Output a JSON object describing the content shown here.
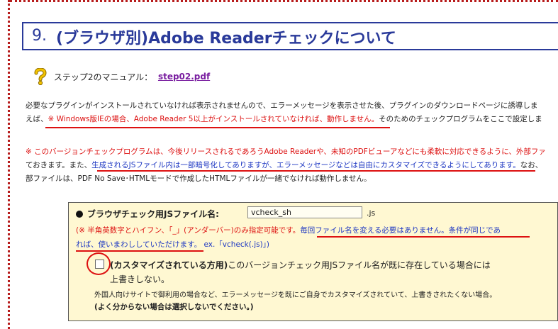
{
  "section": {
    "number": "9.",
    "title": "(ブラウザ別)Adobe Readerチェックについて"
  },
  "step": {
    "label": "ステップ2のマニュアル：",
    "link": "step02.pdf"
  },
  "para1": {
    "line1": "必要なプラグインがインストールされていなければ表示されませんので、エラーメッセージを表示させた後、プラグインのダウンロードページに誘導しま",
    "line2_prefix": "えば、",
    "line2_highlight": "※ Windows版IEの場合、Adobe Reader 5以上がインストールされていなければ、動作しません。",
    "line2_suffix": "そのためのチェックプログラムをここで設定しま"
  },
  "para2": {
    "line1": "※ このバージョンチェックプログラムは、今後リリースされるであろうAdobe Readerや、未知のPDFビューアなどにも柔軟に対応できるように、外部ファ",
    "line2_prefix": "ておきます。また、",
    "line2_highlight": "生成されるJSファイル内は一部暗号化してありますが、エラーメッセージなどは自由にカスタマイズできるようにしてあります。",
    "line2_suffix": "なお、",
    "line3": "部ファイルは、PDF No Save･HTMLモードで作成したHTMLファイルが一緒でなければ動作しません。"
  },
  "form": {
    "js_label": "ブラウザチェック用JSファイル名:",
    "js_value": "vcheck_sh",
    "js_suffix": ".js",
    "note_red": "(※ 半角英数字とハイフン、「_」(アンダーバー)のみ指定可能です。",
    "note_blue1": "毎回ファイル名を変える必要はありません。条件が同じであ",
    "note_blue2": "れば、使いまわししていただけます。",
    "note_example": "ex.「vcheck(.js)」)",
    "option_title": "(カスタマイズされている方用)",
    "option_text1": "このバージョンチェック用JSファイル名が既に存在している場合には",
    "option_text2": "上書きしない。",
    "option_desc": "外国人向けサイトで御利用の場合など、エラーメッセージを既にご自身でカスタマイズされていて、上書きされたくない場合。",
    "option_bold": "(よく分からない場合は選択しないでください。)"
  }
}
